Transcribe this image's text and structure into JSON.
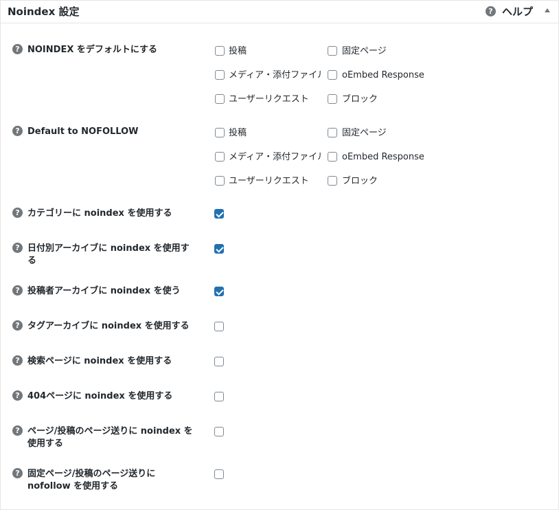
{
  "header": {
    "title": "Noindex 設定",
    "help_icon": "question-icon",
    "help_label": "ヘルプ",
    "toggle_icon": "triangle-up-icon"
  },
  "post_types": [
    "投稿",
    "固定ページ",
    "メディア・添付ファイル",
    "oEmbed Response",
    "ユーザーリクエスト",
    "ブロック"
  ],
  "rows": {
    "noindex_default": {
      "label": "NOINDEX をデフォルトにする"
    },
    "nofollow_default": {
      "label": "Default to NOFOLLOW"
    },
    "category": {
      "label": "カテゴリーに noindex を使用する",
      "checked": true
    },
    "date_archive": {
      "label_line1": "日付別アーカイブに noindex を使用す",
      "label_line2": "る",
      "checked": true
    },
    "author_archive": {
      "label": "投稿者アーカイブに noindex を使う",
      "checked": true
    },
    "tag_archive": {
      "label": "タグアーカイブに noindex を使用する",
      "checked": false
    },
    "search_page": {
      "label": "検索ページに noindex を使用する",
      "checked": false
    },
    "404_page": {
      "label": "404ページに noindex を使用する",
      "checked": false
    },
    "pagination_noindex": {
      "label_line1": "ページ/投稿のページ送りに noindex を",
      "label_line2": "使用する",
      "checked": false
    },
    "pagination_nofollow": {
      "label_line1": "固定ページ/投稿のページ送りに",
      "label_line2": "nofollow を使用する",
      "checked": false
    }
  },
  "colors": {
    "accent": "#2271b1",
    "icon_gray": "#72777c",
    "text": "#23282d",
    "border": "#e5e5e5"
  }
}
